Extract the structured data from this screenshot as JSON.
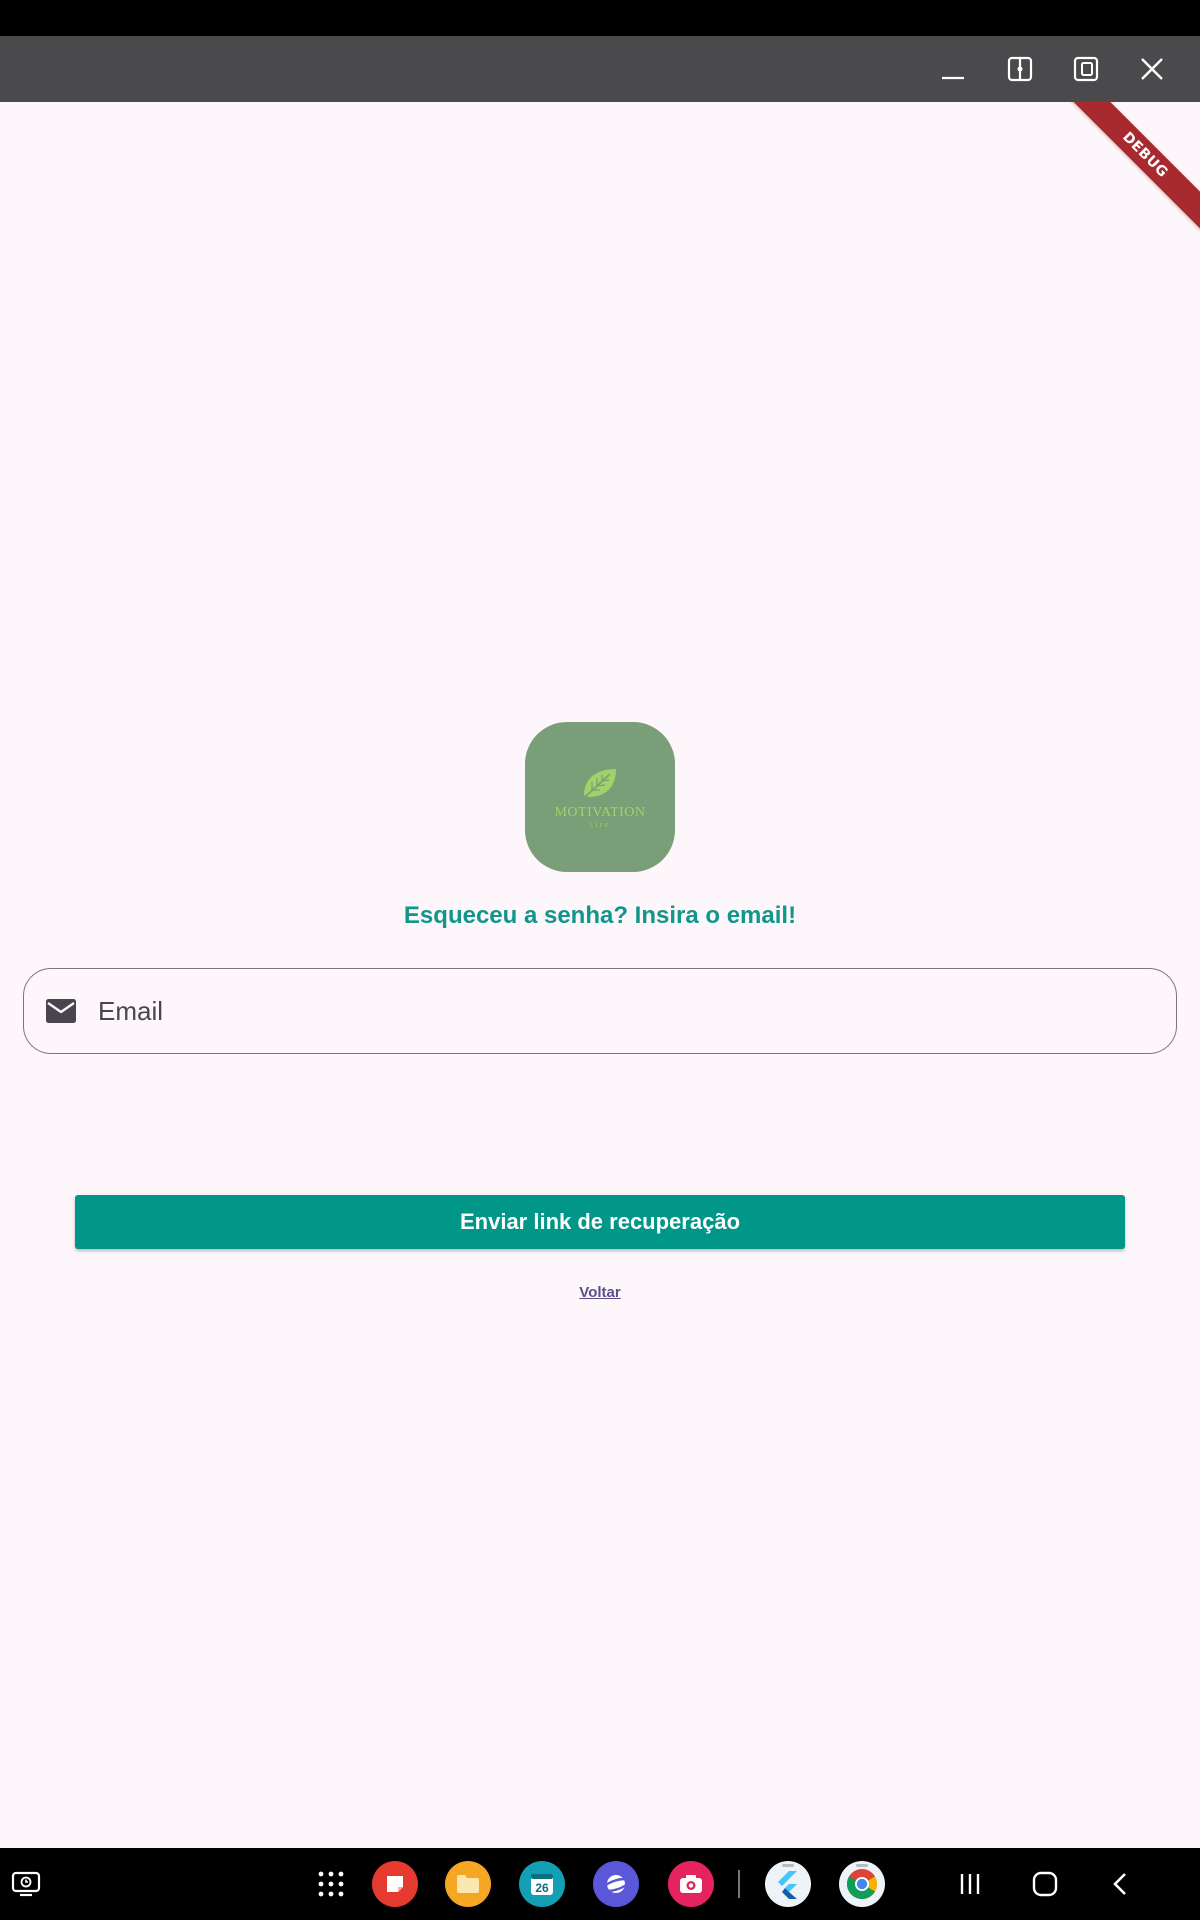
{
  "colors": {
    "title_bar": "#4a4a4c",
    "app_background": "#fdf7fc",
    "accent": "#009688",
    "heading": "#10968a",
    "logo_background": "#7a9e77",
    "debug_ribbon": "#a8292e",
    "link": "#5a4f8a"
  },
  "window_controls": {
    "icons": [
      "minimize-icon",
      "split-view-icon",
      "popup-view-icon",
      "close-icon"
    ]
  },
  "debug_ribbon": {
    "label": "DEBUG"
  },
  "logo": {
    "icon": "leaf-icon",
    "brand": "MOTIVATION",
    "sub": "LIFE"
  },
  "form": {
    "heading": "Esqueceu a senha? Insira o email!",
    "email": {
      "icon": "mail-icon",
      "placeholder": "Email",
      "value": ""
    },
    "submit_label": "Enviar link de recuperação",
    "back_label": "Voltar"
  },
  "taskbar": {
    "calendar_day": "26",
    "icons": [
      "recent-screen-icon",
      "apps-grid-icon",
      "notes-app-icon",
      "files-app-icon",
      "calendar-app-icon",
      "internet-app-icon",
      "camera-app-icon",
      "flutter-app-icon",
      "chrome-app-icon",
      "recents-nav-icon",
      "home-nav-icon",
      "back-nav-icon"
    ]
  }
}
